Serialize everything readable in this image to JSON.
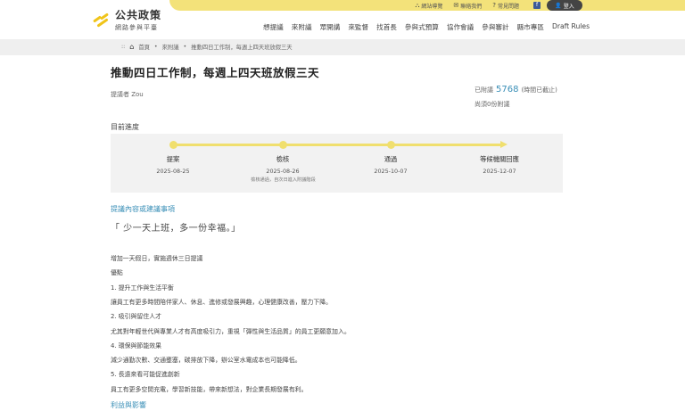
{
  "header": {
    "logo_title": "公共政策",
    "logo_subtitle": "網路參與平臺",
    "util_links": [
      {
        "icon": "sitemap-icon",
        "label": "網站導覽"
      },
      {
        "icon": "mail-icon",
        "label": "聯絡我們"
      },
      {
        "icon": "help-icon",
        "label": "常見問題"
      }
    ],
    "facebook_label": "f",
    "login_label": "登入",
    "nav": [
      "想提議",
      "來附議",
      "眾開講",
      "來監督",
      "找首長",
      "參與式預算",
      "協作會議",
      "參與審計",
      "縣市專區",
      "Draft Rules"
    ]
  },
  "breadcrumb": [
    "首頁",
    "來附議",
    "推動四日工作制，每週上四天班放假三天"
  ],
  "proposal": {
    "title": "推動四日工作制，每週上四天班放假三天",
    "proposer": "提議者 Zou",
    "votes_prefix": "已附議",
    "votes_count": "5768",
    "votes_suffix": "(時間已截止)",
    "votes_need": "尚須0份附議"
  },
  "progress": {
    "heading": "目前進度",
    "stages": [
      {
        "name": "提案",
        "date": "2025-08-25"
      },
      {
        "name": "檢核",
        "date": "2025-08-26"
      },
      {
        "name": "通過",
        "date": "2025-10-07"
      },
      {
        "name": "等候機關回應",
        "date": "2025-12-07"
      }
    ],
    "note": "檢核通過，自次日進入附議階段"
  },
  "content": {
    "heading": "提議內容或建議事項",
    "quote": "「 少一天上班，多一份幸福。」",
    "lines": [
      "增加一天假日，實施週休三日提議",
      "優點",
      "1. 提升工作與生活平衡",
      "讓員工有更多時間陪伴家人、休息、進修或發展興趣，心理健康改善，壓力下降。",
      "2. 吸引與留住人才",
      "尤其對年輕世代與專業人才有高度吸引力，重視「彈性與生活品質」的員工更願意加入。",
      "4. 環保與節能效果",
      "減少通勤次數、交通壅塞，碳排放下降，辦公室水電成本也可能降低。",
      "5. 長遠來看可能促進創新",
      "員工有更多空閒充電，學習新技能，帶來新想法，對企業長期發展有利。"
    ],
    "next_heading": "利益與影響"
  }
}
